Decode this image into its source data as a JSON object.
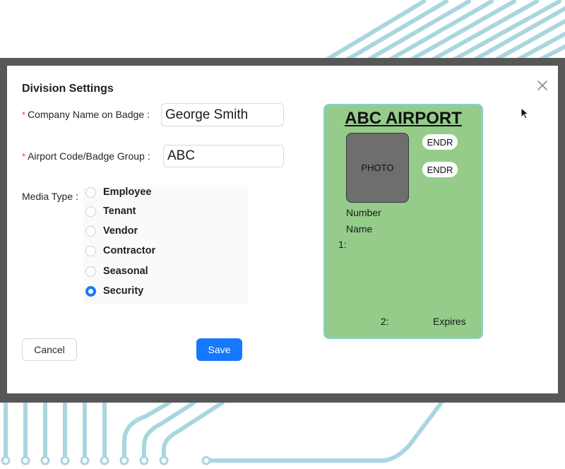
{
  "dialog": {
    "title": "Division Settings",
    "close_icon": "close-icon"
  },
  "form": {
    "company_name": {
      "label": "Company Name on Badge",
      "value": "George Smith",
      "required": true
    },
    "airport_code": {
      "label": "Airport Code/Badge Group",
      "value": "ABC",
      "required": true
    },
    "label_separator": ":",
    "media_type": {
      "label": "Media Type",
      "options": [
        "Employee",
        "Tenant",
        "Vendor",
        "Contractor",
        "Seasonal",
        "Security"
      ],
      "selected": "Security"
    }
  },
  "buttons": {
    "cancel": "Cancel",
    "save": "Save"
  },
  "badge_preview": {
    "title": "ABC AIRPORT",
    "photo": "PHOTO",
    "endorsements": [
      "ENDR",
      "ENDR"
    ],
    "number": "Number",
    "name": "Name",
    "line1": "1:",
    "line2": "2:",
    "expires": "Expires"
  },
  "colors": {
    "accent": "#1677ff",
    "badge_background": "#95cc8a",
    "badge_border": "#82d3cc",
    "required_marker": "#e5484d",
    "circuit_lines": "#a9d6df"
  }
}
